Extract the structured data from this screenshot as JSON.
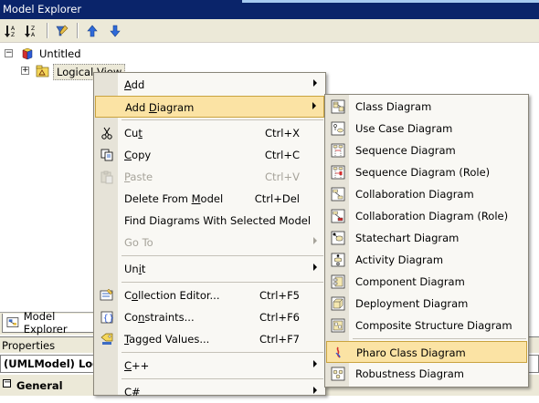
{
  "window": {
    "title": "Model Explorer"
  },
  "toolbar": {
    "buttons": [
      {
        "name": "sort-ascending-icon"
      },
      {
        "name": "sort-descending-icon"
      },
      {
        "name": "filter-icon"
      },
      {
        "name": "move-up-icon"
      },
      {
        "name": "move-down-icon"
      }
    ]
  },
  "tree": {
    "root": {
      "label": "Untitled",
      "expander": "−"
    },
    "child": {
      "label": "Logical View",
      "expander": "+"
    }
  },
  "context_menu": {
    "items": [
      {
        "id": "add",
        "label": "Add",
        "underline": "A",
        "shortcut": "",
        "submenu": true,
        "disabled": false,
        "highlighted": false,
        "icon": ""
      },
      {
        "id": "add-diagram",
        "label": "Add Diagram",
        "underline": "D",
        "shortcut": "",
        "submenu": true,
        "disabled": false,
        "highlighted": true,
        "icon": ""
      },
      {
        "id": "cut",
        "label": "Cut",
        "underline": "t",
        "shortcut": "Ctrl+X",
        "submenu": false,
        "disabled": false,
        "highlighted": false,
        "icon": "scissors-icon"
      },
      {
        "id": "copy",
        "label": "Copy",
        "underline": "C",
        "shortcut": "Ctrl+C",
        "submenu": false,
        "disabled": false,
        "highlighted": false,
        "icon": "copy-icon"
      },
      {
        "id": "paste",
        "label": "Paste",
        "underline": "P",
        "shortcut": "Ctrl+V",
        "submenu": false,
        "disabled": true,
        "highlighted": false,
        "icon": "paste-icon"
      },
      {
        "id": "delete",
        "label": "Delete From Model",
        "underline": "M",
        "shortcut": "Ctrl+Del",
        "submenu": false,
        "disabled": false,
        "highlighted": false,
        "icon": ""
      },
      {
        "id": "find",
        "label": "Find Diagrams With Selected Model",
        "underline": "",
        "shortcut": "",
        "submenu": false,
        "disabled": false,
        "highlighted": false,
        "icon": ""
      },
      {
        "id": "goto",
        "label": "Go To",
        "underline": "",
        "shortcut": "",
        "submenu": true,
        "disabled": true,
        "highlighted": false,
        "icon": ""
      },
      {
        "id": "unit",
        "label": "Unit",
        "underline": "i",
        "shortcut": "",
        "submenu": true,
        "disabled": false,
        "highlighted": false,
        "icon": ""
      },
      {
        "id": "collection",
        "label": "Collection Editor...",
        "underline": "o",
        "shortcut": "Ctrl+F5",
        "submenu": false,
        "disabled": false,
        "highlighted": false,
        "icon": "collection-editor-icon"
      },
      {
        "id": "constraints",
        "label": "Constraints...",
        "underline": "n",
        "shortcut": "Ctrl+F6",
        "submenu": false,
        "disabled": false,
        "highlighted": false,
        "icon": "constraints-icon"
      },
      {
        "id": "tagged",
        "label": "Tagged Values...",
        "underline": "T",
        "shortcut": "Ctrl+F7",
        "submenu": false,
        "disabled": false,
        "highlighted": false,
        "icon": "tagged-values-icon"
      },
      {
        "id": "cpp",
        "label": "C++",
        "underline": "C",
        "shortcut": "",
        "submenu": true,
        "disabled": false,
        "highlighted": false,
        "icon": ""
      },
      {
        "id": "csharp",
        "label": "C#",
        "underline": "",
        "shortcut": "",
        "submenu": true,
        "disabled": false,
        "highlighted": false,
        "icon": ""
      }
    ]
  },
  "diagram_submenu": {
    "items": [
      {
        "label": "Class Diagram",
        "icon": "class-diagram-icon",
        "highlighted": false
      },
      {
        "label": "Use Case Diagram",
        "icon": "use-case-diagram-icon",
        "highlighted": false
      },
      {
        "label": "Sequence Diagram",
        "icon": "sequence-diagram-icon",
        "highlighted": false
      },
      {
        "label": "Sequence Diagram (Role)",
        "icon": "sequence-role-diagram-icon",
        "highlighted": false
      },
      {
        "label": "Collaboration Diagram",
        "icon": "collaboration-diagram-icon",
        "highlighted": false
      },
      {
        "label": "Collaboration Diagram (Role)",
        "icon": "collaboration-role-diagram-icon",
        "highlighted": false
      },
      {
        "label": "Statechart Diagram",
        "icon": "statechart-diagram-icon",
        "highlighted": false
      },
      {
        "label": "Activity Diagram",
        "icon": "activity-diagram-icon",
        "highlighted": false
      },
      {
        "label": "Component Diagram",
        "icon": "component-diagram-icon",
        "highlighted": false
      },
      {
        "label": "Deployment Diagram",
        "icon": "deployment-diagram-icon",
        "highlighted": false
      },
      {
        "label": "Composite Structure Diagram",
        "icon": "composite-structure-diagram-icon",
        "highlighted": false
      },
      {
        "label": "Pharo Class Diagram",
        "icon": "pharo-class-diagram-icon",
        "highlighted": true
      },
      {
        "label": "Robustness Diagram",
        "icon": "robustness-diagram-icon",
        "highlighted": false
      }
    ]
  },
  "bottom": {
    "explorer_tab": "Model Explorer",
    "properties_header": "Properties",
    "selection": "(UMLModel) Logic",
    "category": "General",
    "category_expander": "−"
  },
  "colors": {
    "titlebar": "#0a246a",
    "menu_highlight": "#fbe3a4",
    "menu_highlight_border": "#c9a33e",
    "disabled_text": "#a6a39a"
  }
}
